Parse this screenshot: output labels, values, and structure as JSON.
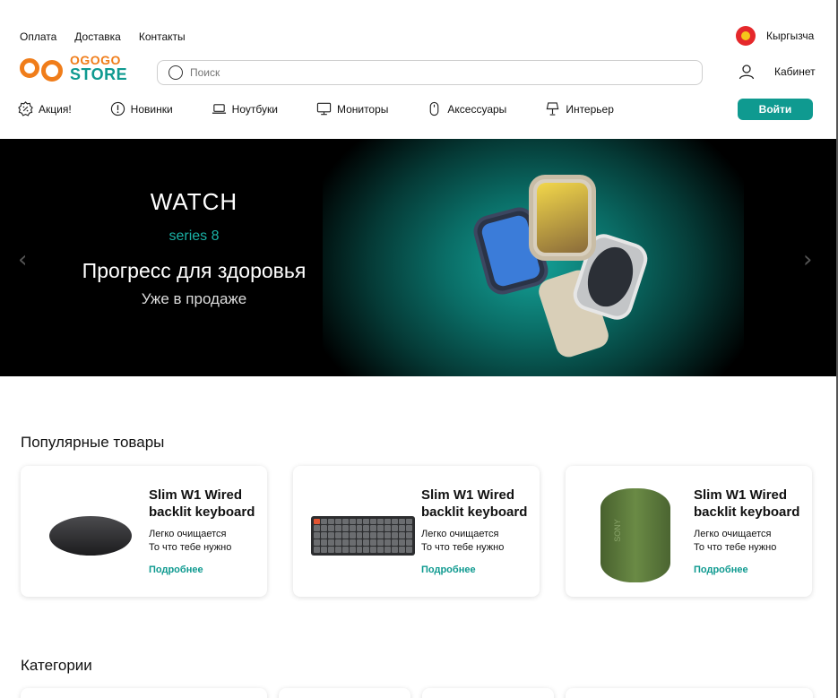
{
  "header": {
    "links": [
      "Оплата",
      "Доставка",
      "Контакты"
    ],
    "language": "Кыргызча",
    "logo_line1": "OGOGO",
    "logo_line2": "STORE",
    "search_placeholder": "Поиск",
    "cabinet": "Кабинет",
    "login": "Войти"
  },
  "nav": {
    "items": [
      {
        "label": "Акция!",
        "icon": "promo-badge-icon"
      },
      {
        "label": "Новинки",
        "icon": "info-icon"
      },
      {
        "label": "Ноутбуки",
        "icon": "laptop-icon"
      },
      {
        "label": "Мониторы",
        "icon": "monitor-icon"
      },
      {
        "label": "Аксессуары",
        "icon": "mouse-icon"
      },
      {
        "label": "Интерьер",
        "icon": "lamp-icon"
      }
    ]
  },
  "hero": {
    "title": "WATCH",
    "subtitle": "series 8",
    "headline": "Прогресс для здоровья",
    "tagline": "Уже в продаже",
    "prev_icon": "chevron-left-icon",
    "next_icon": "chevron-right-icon"
  },
  "popular": {
    "title": "Популярные товары",
    "products": [
      {
        "title": "Slim W1 Wired backlit keyboard",
        "desc1": "Легко очищается",
        "desc2": "То что тебе нужно",
        "more": "Подробнее",
        "image": "mouse"
      },
      {
        "title": "Slim W1 Wired backlit keyboard",
        "desc1": "Легко очищается",
        "desc2": "То что тебе нужно",
        "more": "Подробнее",
        "image": "keyboard"
      },
      {
        "title": "Slim W1 Wired backlit keyboard",
        "desc1": "Легко очищается",
        "desc2": "То что тебе нужно",
        "more": "Подробнее",
        "image": "speaker"
      }
    ]
  },
  "categories": {
    "title": "Категории"
  },
  "colors": {
    "accent": "#0f9a90",
    "brand_orange": "#f07d1a"
  }
}
